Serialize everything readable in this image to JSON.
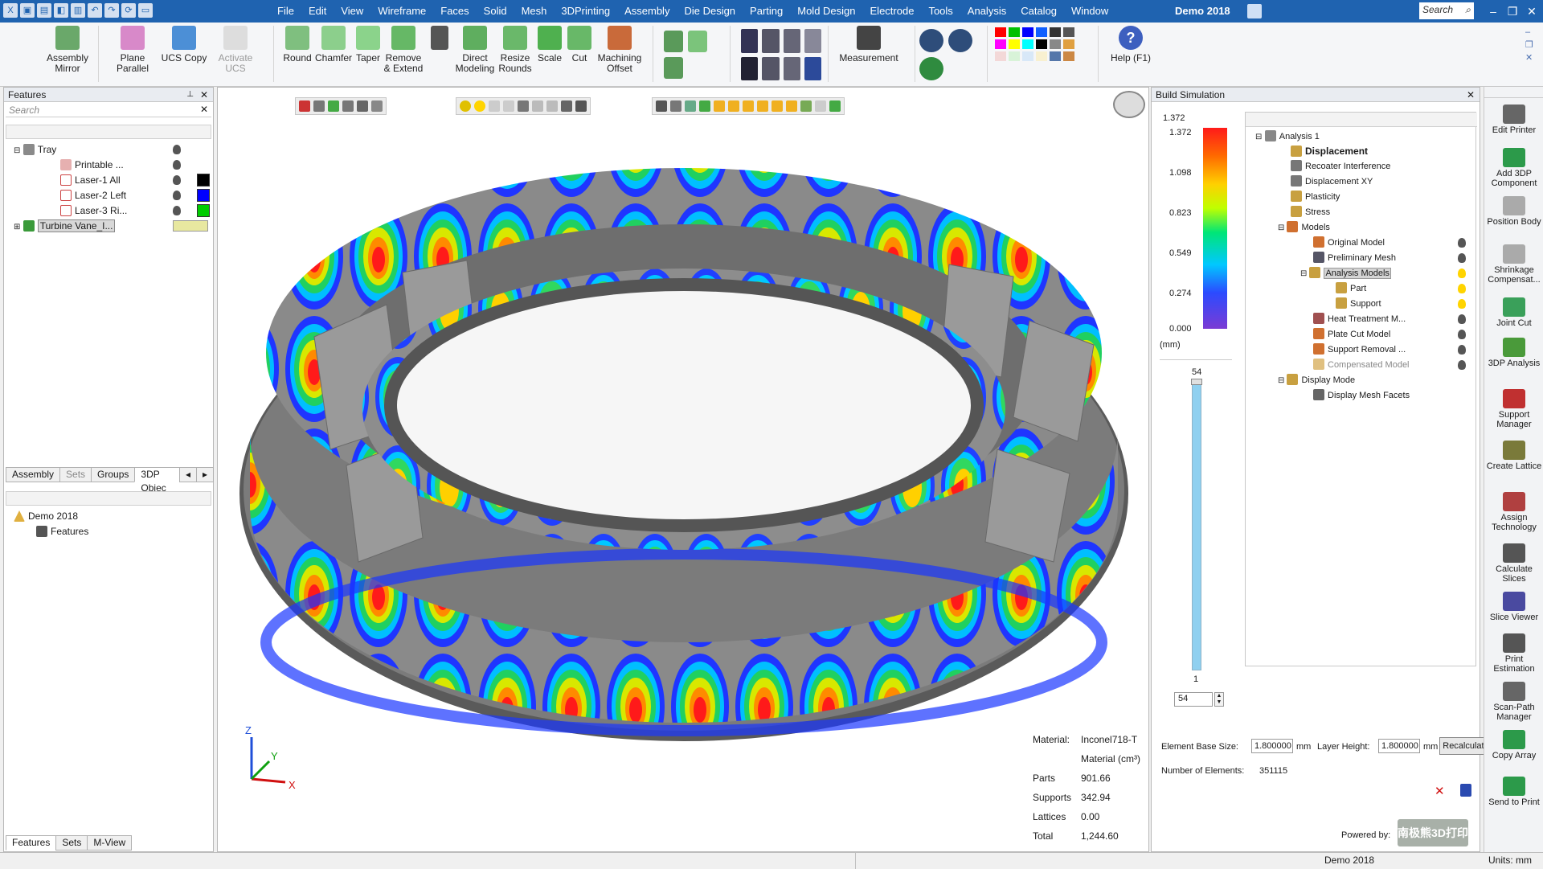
{
  "titlebar": {
    "title": "Demo 2018",
    "search_placeholder": "Search",
    "menu": [
      "File",
      "Edit",
      "View",
      "Wireframe",
      "Faces",
      "Solid",
      "Mesh",
      "3DPrinting",
      "Assembly",
      "Die Design",
      "Parting",
      "Mold Design",
      "Electrode",
      "Tools",
      "Analysis",
      "Catalog",
      "Window"
    ]
  },
  "ribbon": {
    "buttons": [
      "Assembly Mirror",
      "Plane Parallel",
      "UCS Copy",
      "Activate UCS",
      "Round",
      "Chamfer",
      "Taper",
      "Remove & Extend",
      "Direct Modeling",
      "Resize Rounds",
      "Scale",
      "Cut",
      "Machining Offset",
      "Measurement",
      "Help (F1)"
    ]
  },
  "features": {
    "title": "Features",
    "search_placeholder": "Search",
    "tree": [
      {
        "label": "Tray"
      },
      {
        "label": "Printable ..."
      },
      {
        "label": "Laser-1 All",
        "color": "#000000"
      },
      {
        "label": "Laser-2 Left",
        "color": "#0000ff"
      },
      {
        "label": "Laser-3 Ri...",
        "color": "#00cc00"
      },
      {
        "label": "Turbine Vane_I..."
      }
    ],
    "tabs": [
      "Assembly",
      "Sets",
      "Groups",
      "3DP Objec"
    ],
    "tree2": [
      "Demo 2018",
      "Features"
    ],
    "bottom_tabs": [
      "Features",
      "Sets",
      "M-View"
    ]
  },
  "material": {
    "material_label": "Material:",
    "material_value": "Inconel718-T",
    "volume_label": "Material (cm³)",
    "rows": [
      {
        "label": "Parts",
        "value": "901.66"
      },
      {
        "label": "Supports",
        "value": "342.94"
      },
      {
        "label": "Lattices",
        "value": "0.00"
      },
      {
        "label": "Total",
        "value": "1,244.60"
      }
    ]
  },
  "axes": {
    "x": "X",
    "y": "Y",
    "z": "Z"
  },
  "simulation": {
    "title": "Build Simulation",
    "legend_max": "1.372",
    "legend_ticks": [
      "1.372",
      "1.098",
      "0.823",
      "0.549",
      "0.274",
      "0.000"
    ],
    "unit": "(mm)",
    "slider_top": "54",
    "slider_bottom": "1",
    "slider_value": "54",
    "tree": [
      "Analysis 1",
      "Displacement",
      "Recoater Interference",
      "Displacement XY",
      "Plasticity",
      "Stress",
      "Models",
      "Original Model",
      "Preliminary Mesh",
      "Analysis Models",
      "Part",
      "Support",
      "Heat Treatment M...",
      "Plate Cut Model",
      "Support Removal ...",
      "Compensated Model",
      "Display Mode",
      "Display Mesh Facets"
    ],
    "element_base_label": "Element Base Size:",
    "element_base_value": "1.800000",
    "unit_mm": "mm",
    "layer_height_label": "Layer Height:",
    "layer_height_value": "1.800000",
    "recalculate": "Recalculate",
    "num_elements_label": "Number of Elements:",
    "num_elements_value": "351115",
    "powered_by": "Powered by:",
    "watermark": "南极熊3D打印"
  },
  "rightstrip": [
    "Edit Printer",
    "Add 3DP Component",
    "Position Body",
    "Shrinkage Compensat...",
    "Joint Cut",
    "3DP Analysis",
    "Support Manager",
    "Create Lattice",
    "Assign Technology",
    "Calculate Slices",
    "Slice Viewer",
    "Print Estimation",
    "Scan-Path Manager",
    "Copy Array",
    "Send to Print"
  ],
  "status": {
    "center": "Demo 2018",
    "units": "Units: mm"
  }
}
